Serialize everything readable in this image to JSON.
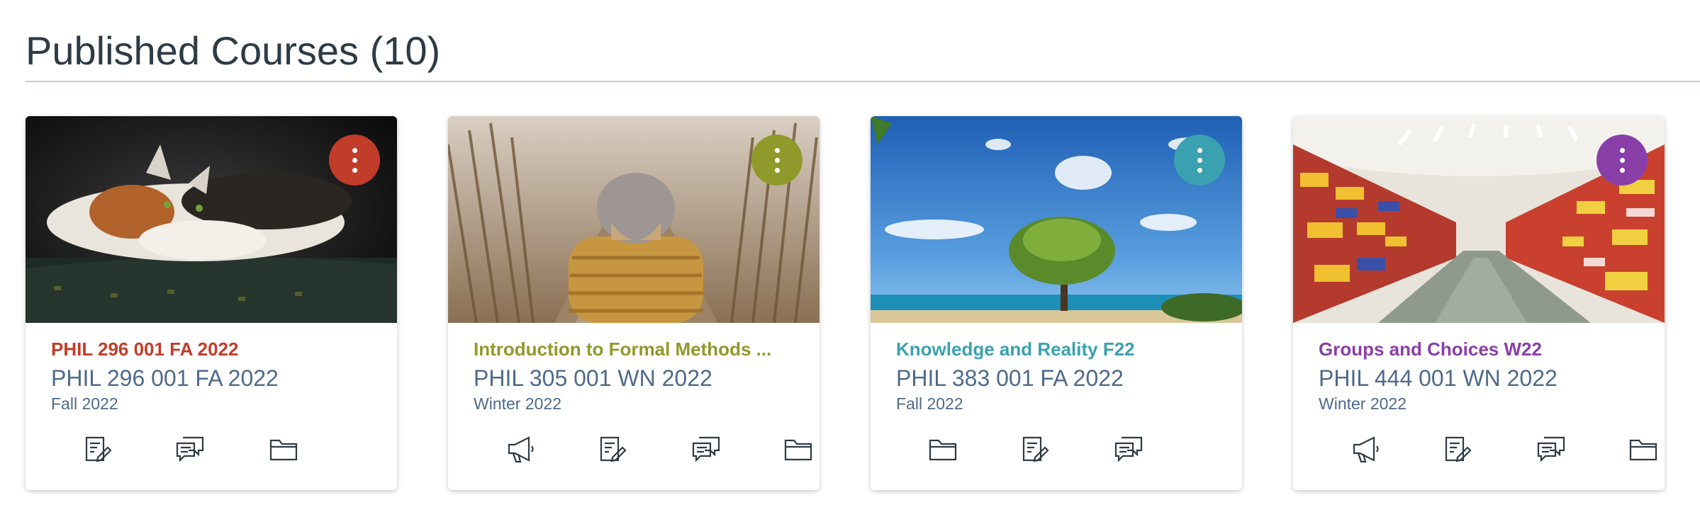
{
  "header": {
    "title": "Published Courses (10)"
  },
  "cards": [
    {
      "title": "PHIL 296 001 FA 2022",
      "code": "PHIL 296 001 FA 2022",
      "term": "Fall 2022",
      "color": "#c23c2a"
    },
    {
      "title": "Introduction to Formal Methods ...",
      "code": "PHIL 305 001 WN 2022",
      "term": "Winter 2022",
      "color": "#8f9a2a"
    },
    {
      "title": "Knowledge and Reality F22",
      "code": "PHIL 383 001 FA 2022",
      "term": "Fall 2022",
      "color": "#3aa1b0"
    },
    {
      "title": "Groups and Choices W22",
      "code": "PHIL 444 001 WN 2022",
      "term": "Winter 2022",
      "color": "#8a3ea8"
    }
  ]
}
